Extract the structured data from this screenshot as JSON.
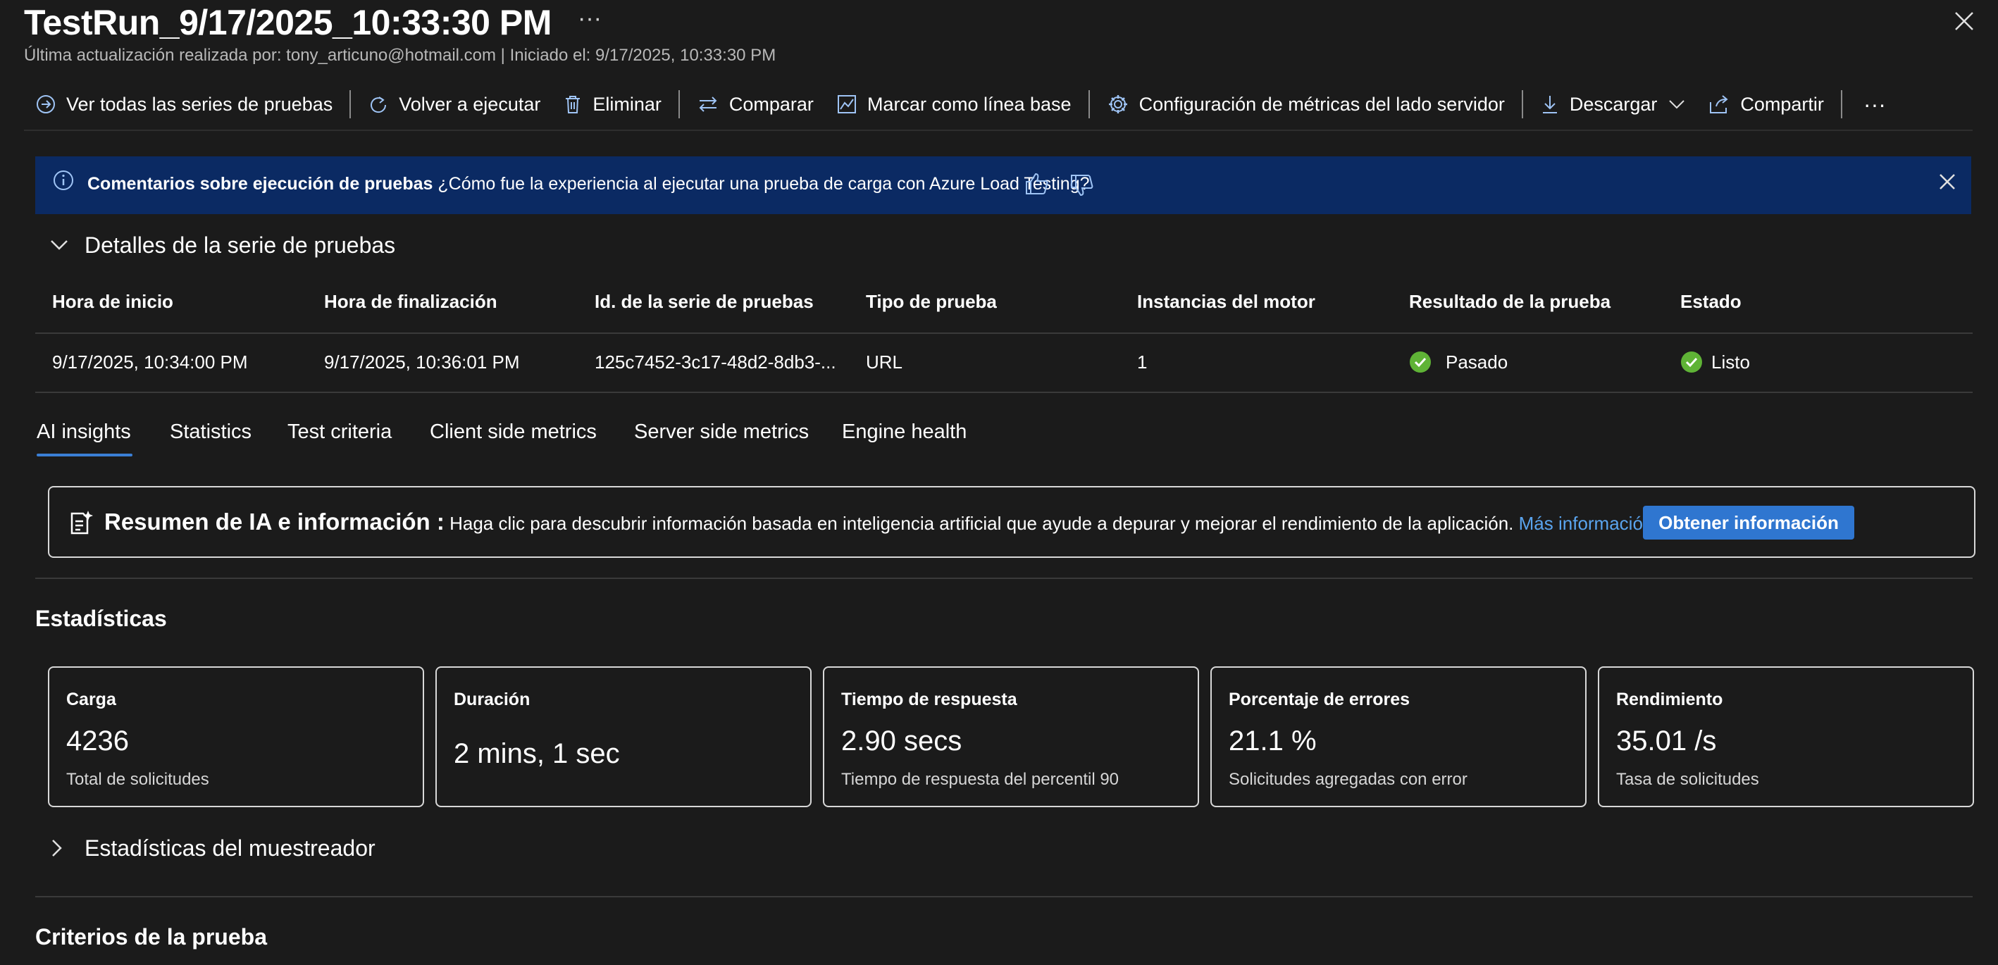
{
  "header": {
    "title": "TestRun_9/17/2025_10:33:30 PM",
    "more": "···",
    "subtitle": "Última actualización realizada por: tony_articuno@hotmail.com | Iniciado el: 9/17/2025, 10:33:30 PM"
  },
  "toolbar": {
    "view_all": "Ver todas las series de pruebas",
    "rerun": "Volver a ejecutar",
    "delete": "Eliminar",
    "compare": "Comparar",
    "baseline": "Marcar como línea base",
    "server_metrics_config": "Configuración de métricas del lado servidor",
    "download": "Descargar",
    "share": "Compartir",
    "more": "···"
  },
  "banner": {
    "title": "Comentarios sobre ejecución de pruebas",
    "question": "¿Cómo fue la experiencia al ejecutar una prueba de carga con Azure Load Testing?"
  },
  "details": {
    "section_title": "Detalles de la serie de pruebas",
    "columns": [
      "Hora de inicio",
      "Hora de finalización",
      "Id. de la serie de pruebas",
      "Tipo de prueba",
      "Instancias del motor",
      "Resultado de la prueba",
      "Estado"
    ],
    "row": [
      "9/17/2025, 10:34:00 PM",
      "9/17/2025, 10:36:01 PM",
      "125c7452-3c17-48d2-8db3-...",
      "URL",
      "1",
      "Pasado",
      "Listo"
    ]
  },
  "tabs": [
    "AI insights",
    "Statistics",
    "Test criteria",
    "Client side metrics",
    "Server side metrics",
    "Engine health"
  ],
  "ai_summary": {
    "title": "Resumen de IA e información :",
    "text": "Haga clic para descubrir información basada en inteligencia artificial que ayude a depurar y mejorar el rendimiento de la aplicación.",
    "link": "Más información",
    "button": "Obtener información"
  },
  "statistics": {
    "title": "Estadísticas",
    "cards": [
      {
        "label": "Carga",
        "value": "4236",
        "sub": "Total de solicitudes"
      },
      {
        "label": "Duración",
        "value": "2 mins, 1 sec",
        "sub": ""
      },
      {
        "label": "Tiempo de respuesta",
        "value": "2.90 secs",
        "sub": "Tiempo de respuesta del percentil 90"
      },
      {
        "label": "Porcentaje de errores",
        "value": "21.1 %",
        "sub": "Solicitudes agregadas con error"
      },
      {
        "label": "Rendimiento",
        "value": "35.01 /s",
        "sub": "Tasa de solicitudes"
      }
    ]
  },
  "sampler": {
    "title": "Estadísticas del muestreador"
  },
  "criteria": {
    "title": "Criterios de la prueba"
  },
  "colors": {
    "background": "#1b1b1b",
    "banner": "#0b2a63",
    "accent": "#2f76d0",
    "link": "#5aa4ee",
    "success": "#5fb336"
  }
}
